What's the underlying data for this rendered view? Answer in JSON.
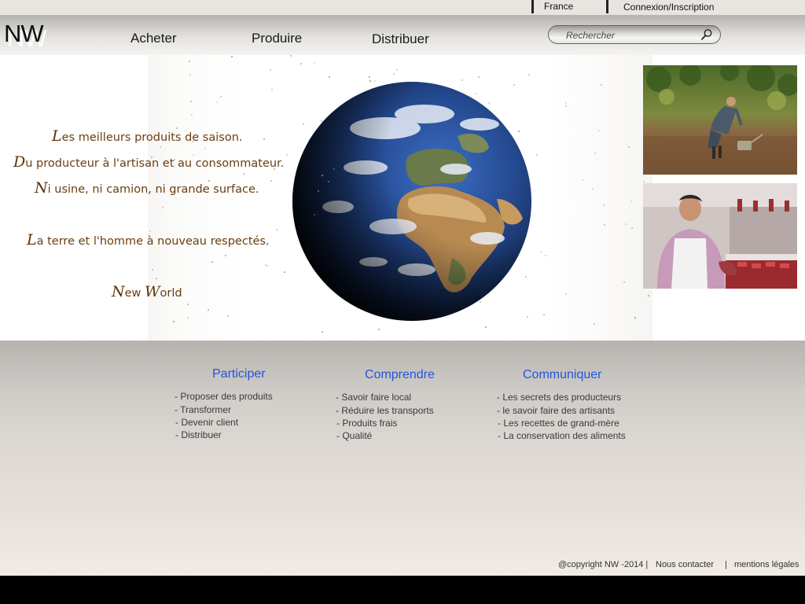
{
  "top_bar": {
    "region": "France",
    "account": "Connexion/Inscription"
  },
  "header": {
    "logo": "NW",
    "nav": [
      "Acheter",
      "Produire",
      "Distribuer"
    ],
    "search_placeholder": "Rechercher"
  },
  "hero": {
    "lines": [
      {
        "cap": "L",
        "rest": "es meilleurs produits de saison."
      },
      {
        "cap": "D",
        "rest": "u producteur à l'artisan et au  consommateur."
      },
      {
        "cap": "N",
        "rest": "i usine, ni camion, ni grande surface."
      },
      {
        "cap": "L",
        "rest": "a terre et l'homme  à nouveau respectés."
      }
    ],
    "signature": {
      "cap1": "N",
      "rest1": "ew ",
      "cap2": "W",
      "rest2": "orld"
    }
  },
  "columns": [
    {
      "title": "Participer",
      "links": [
        "- Proposer des produits",
        "- Transformer",
        "- Devenir client",
        "- Distribuer"
      ]
    },
    {
      "title": "Comprendre",
      "links": [
        "- Savoir faire local",
        "- Réduire les transports",
        "- Produits frais",
        "- Qualité"
      ]
    },
    {
      "title": "Communiquer",
      "links": [
        "- Les secrets des producteurs",
        "- le savoir faire des artisants",
        "- Les recettes de grand-mère",
        "- La conservation des aliments"
      ]
    }
  ],
  "footer": {
    "copyright": "@copyright NW -2014 |",
    "contact": "Nous contacter",
    "divider": "|",
    "legal": "mentions légales"
  },
  "colors": {
    "accent_link": "#2255dd",
    "quote_text": "#6b3d10"
  }
}
